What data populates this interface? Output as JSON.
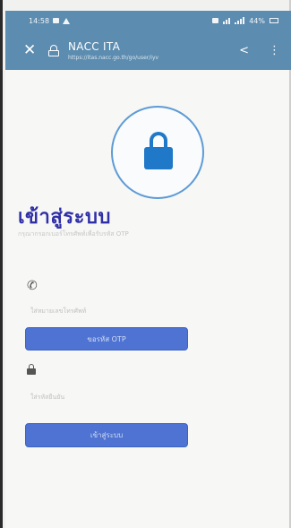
{
  "status_bar": {
    "time": "14:58",
    "battery": "44%"
  },
  "browser": {
    "page_title": "NACC ITA",
    "url": "https://itas.nacc.go.th/go/user/iyv"
  },
  "login": {
    "heading": "เข้าสู่ระบบ",
    "subtitle": "กรุณากรอกเบอร์โทรศัพท์เพื่อรับรหัส OTP",
    "phone_placeholder": "ใส่หมายเลขโทรศัพท์",
    "otp_button": "ขอรหัส OTP",
    "otp_placeholder": "ใส่รหัสยืนยัน",
    "login_button": "เข้าสู่ระบบ"
  },
  "colors": {
    "browser_bar": "#5c8cb0",
    "heading": "#2f2fa8",
    "button": "#4e73d2",
    "lock": "#1f78c8"
  }
}
